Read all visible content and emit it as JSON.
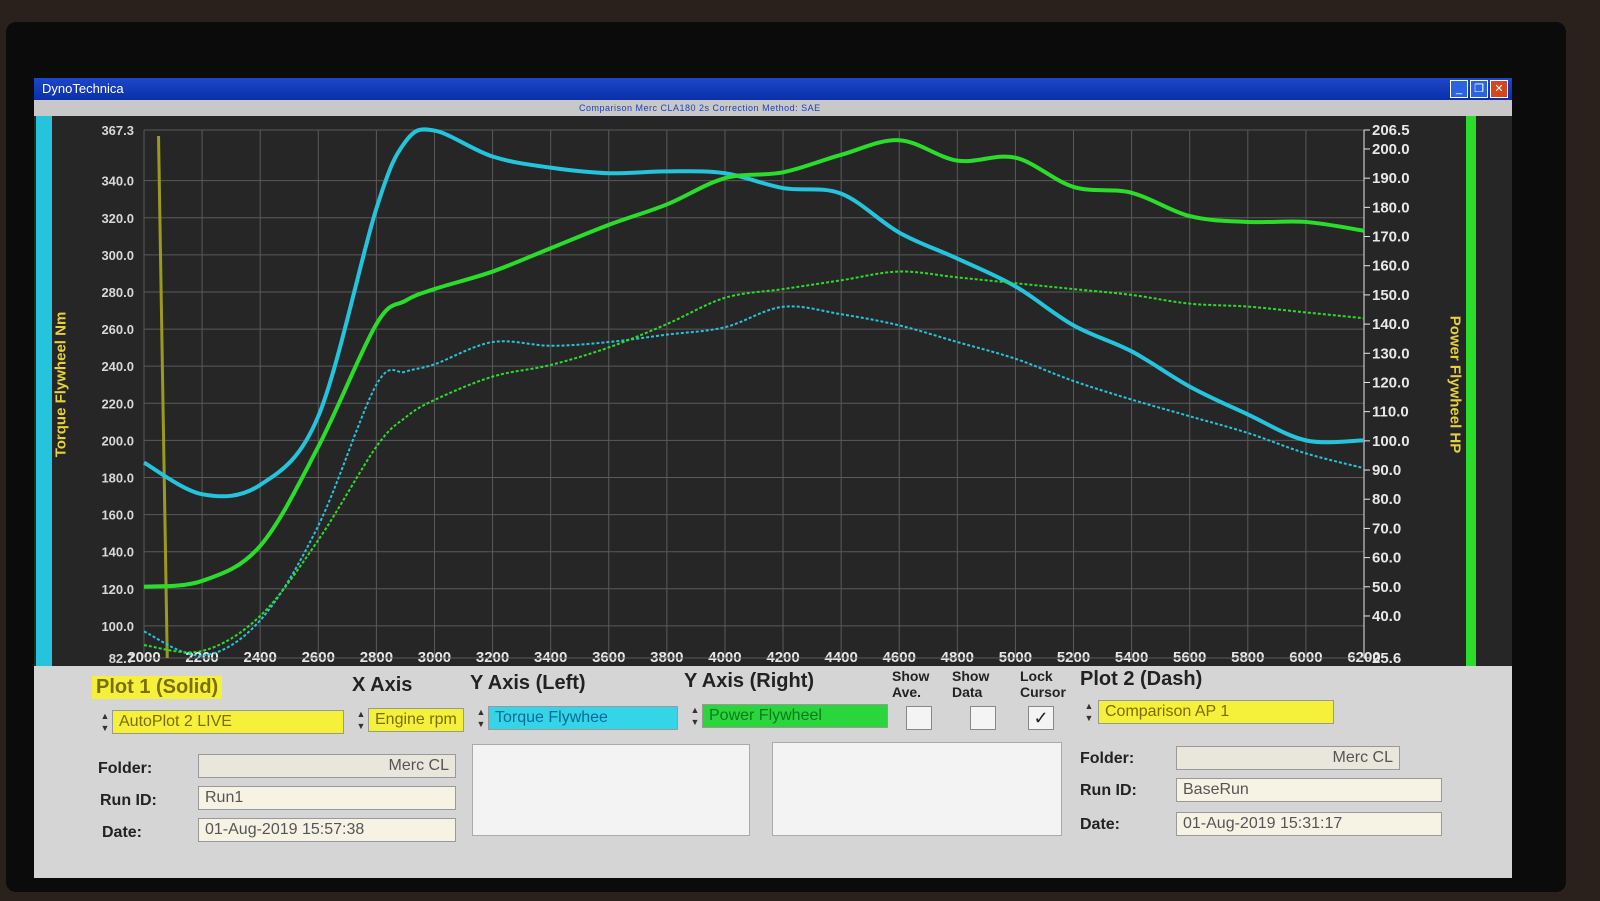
{
  "window": {
    "title": "DynoTechnica",
    "controls": [
      "minimize-icon",
      "restore-icon",
      "close-icon"
    ]
  },
  "menubar": {
    "info_text": "Comparison    Merc CLA180 2s    Correction Method: SAE"
  },
  "colors": {
    "torque_line": "#25c4dd",
    "power_line": "#2bdd2b",
    "axis_title": "#e6d13a",
    "plot_bg": "#262626",
    "grid": "#5a5a5a",
    "panel_bg": "#d5d5d5"
  },
  "chart_data": {
    "type": "line",
    "x": [
      2000,
      2200,
      2400,
      2600,
      2800,
      2900,
      3000,
      3200,
      3400,
      3600,
      3800,
      4000,
      4200,
      4400,
      4600,
      4800,
      5000,
      5200,
      5400,
      5600,
      5800,
      6000,
      6200
    ],
    "x_ticks": [
      "2000",
      "2200",
      "2400",
      "2600",
      "2800",
      "3000",
      "3200",
      "3400",
      "3600",
      "3800",
      "4000",
      "4200",
      "4400",
      "4600",
      "4800",
      "5000",
      "5200",
      "5400",
      "5600",
      "5800",
      "6000",
      "6200"
    ],
    "xlim": [
      2000,
      6200
    ],
    "y_left": {
      "label": "Torque Flywheel Nm",
      "ylim": [
        82.7,
        367.3
      ],
      "ticks": [
        "367.3",
        "340.0",
        "320.0",
        "300.0",
        "280.0",
        "260.0",
        "240.0",
        "220.0",
        "200.0",
        "180.0",
        "160.0",
        "140.0",
        "120.0",
        "100.0",
        "82.7"
      ]
    },
    "y_right": {
      "label": "Power Flywheel HP",
      "ylim": [
        25.6,
        206.5
      ],
      "ticks": [
        "206.5",
        "200.0",
        "190.0",
        "180.0",
        "170.0",
        "160.0",
        "150.0",
        "140.0",
        "130.0",
        "120.0",
        "110.0",
        "100.0",
        "90.0",
        "80.0",
        "70.0",
        "60.0",
        "50.0",
        "40.0",
        "25.6"
      ]
    },
    "grid": true,
    "series": [
      {
        "name": "Torque Flywheel",
        "axis": "left",
        "style": "solid",
        "color": "#25c4dd",
        "values": [
          188,
          171,
          176,
          213,
          325,
          361,
          367,
          353,
          347,
          344,
          345,
          344,
          336,
          333,
          312,
          298,
          283,
          262,
          248,
          229,
          214,
          200,
          200
        ]
      },
      {
        "name": "Power Flywheel",
        "axis": "right",
        "style": "solid",
        "color": "#2bdd2b",
        "values": [
          50,
          52,
          64,
          98,
          140,
          148,
          152,
          158,
          166,
          174,
          181,
          190,
          192,
          198,
          203,
          196,
          197,
          187,
          185,
          177,
          175,
          175,
          172
        ]
      },
      {
        "name": "Torque Flywheel",
        "axis": "left",
        "style": "dash",
        "color": "#25c4dd",
        "values": [
          97,
          84,
          103,
          154,
          230,
          237,
          241,
          253,
          251,
          253,
          257,
          261,
          272,
          268,
          262,
          253,
          244,
          232,
          222,
          213,
          204,
          193,
          185
        ]
      },
      {
        "name": "Power Flywheel",
        "axis": "right",
        "style": "dash",
        "color": "#2bdd2b",
        "values": [
          30,
          28,
          40,
          66,
          98,
          108,
          114,
          122,
          126,
          132,
          140,
          149,
          152,
          155,
          158,
          156,
          154,
          152,
          150,
          147,
          146,
          144,
          142
        ]
      }
    ]
  },
  "panel": {
    "plot1_label": "Plot 1 (Solid)",
    "plot1_value": "AutoPlot 2 LIVE",
    "x_axis_label": "X Axis",
    "x_axis_value": "Engine rpm",
    "y_left_label": "Y Axis (Left)",
    "y_left_value": "Torque Flywhee",
    "y_right_label": "Y Axis (Right)",
    "y_right_value": "Power Flywheel",
    "show_ave_label": "Show Ave.",
    "show_data_label": "Show Data",
    "lock_cursor_label": "Lock Cursor",
    "lock_cursor_checked": true,
    "plot2_label": "Plot 2 (Dash)",
    "plot2_value": "Comparison AP 1",
    "left": {
      "folder_label": "Folder:",
      "folder_value": "Merc CL",
      "run_id_label": "Run ID:",
      "run_id_value": "Run1",
      "date_label": "Date:",
      "date_value": "01-Aug-2019  15:57:38"
    },
    "right": {
      "folder_label": "Folder:",
      "folder_value": "Merc CL",
      "run_id_label": "Run ID:",
      "run_id_value": "BaseRun",
      "date_label": "Date:",
      "date_value": "01-Aug-2019  15:31:17"
    }
  }
}
